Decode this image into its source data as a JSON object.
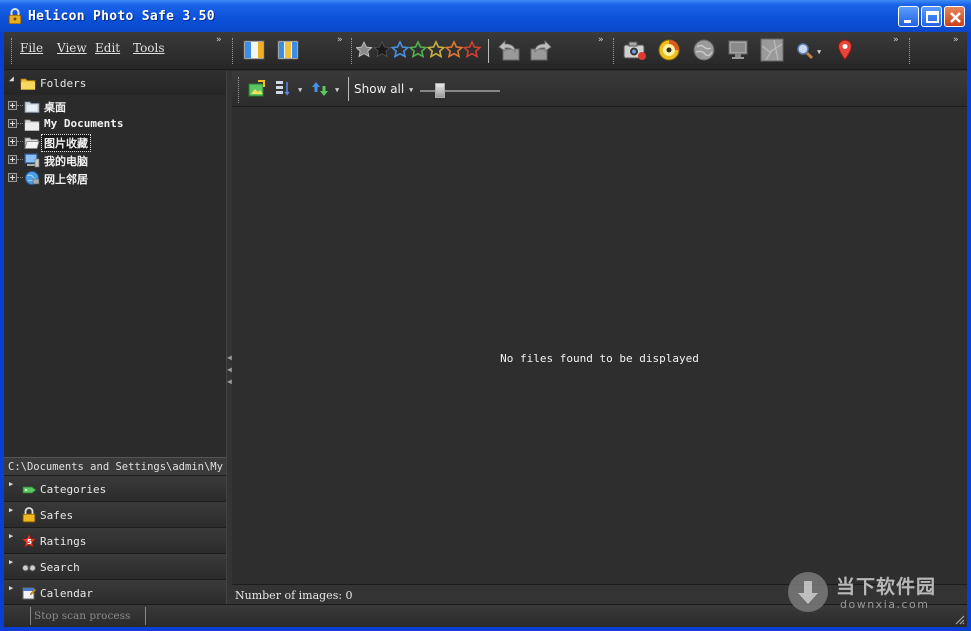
{
  "window": {
    "title": "Helicon Photo Safe 3.50"
  },
  "menu": {
    "file": "File",
    "view": "View",
    "edit": "Edit",
    "tools": "Tools"
  },
  "toolbar": {
    "icons": [
      "panel-layout-1-icon",
      "panel-layout-2-icon",
      "rating-clear-icon",
      "rating-1-icon",
      "rating-2-icon",
      "rating-3-icon",
      "rating-4-icon",
      "rating-5-icon",
      "undo-icon",
      "redo-icon",
      "camera-icon",
      "disc-icon",
      "globe-icon",
      "monitor-icon",
      "map-icon",
      "zoom-icon",
      "map-pin-icon"
    ]
  },
  "folders": {
    "header": "Folders",
    "items": [
      {
        "label": "桌面",
        "icon": "desktop-folder-icon"
      },
      {
        "label": "My Documents",
        "icon": "folder-icon"
      },
      {
        "label": "图片收藏",
        "icon": "folder-open-icon",
        "selected": true
      },
      {
        "label": "我的电脑",
        "icon": "computer-icon"
      },
      {
        "label": "网上邻居",
        "icon": "network-icon"
      }
    ]
  },
  "path": "C:\\Documents and Settings\\admin\\My Documents",
  "sections": [
    {
      "label": "Categories",
      "icon": "tag-icon"
    },
    {
      "label": "Safes",
      "icon": "lock-icon"
    },
    {
      "label": "Ratings",
      "icon": "star-icon"
    },
    {
      "label": "Search",
      "icon": "binoculars-icon"
    },
    {
      "label": "Calendar",
      "icon": "calendar-icon"
    }
  ],
  "view": {
    "filter_label": "Show all",
    "empty_message": "No files found to be displayed",
    "image_count": "Number of images: 0"
  },
  "status": {
    "stop_label": "Stop scan process"
  },
  "watermark": {
    "text": "当下软件园",
    "sub": "downxia.com"
  },
  "colors": {
    "titlebar": "#0b51d8",
    "panel_bg": "#2e2e2e",
    "text": "#e8e8e8"
  }
}
